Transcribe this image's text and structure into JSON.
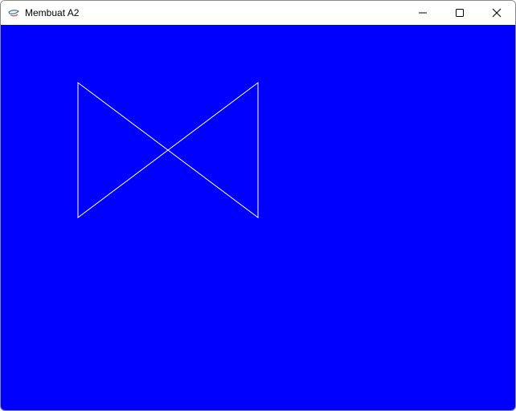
{
  "window": {
    "title": "Membuat A2",
    "app_icon": "java-cup-icon",
    "controls": {
      "minimize_icon": "minimize-icon",
      "maximize_icon": "maximize-icon",
      "close_icon": "close-icon"
    }
  },
  "canvas": {
    "background_color": "#0000ff",
    "line_color": "#ffffff",
    "shape": "bowtie-outline"
  }
}
